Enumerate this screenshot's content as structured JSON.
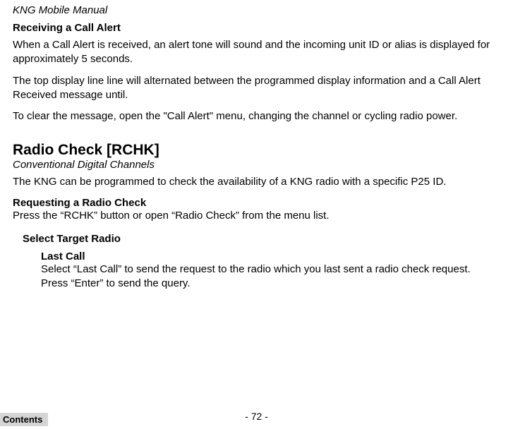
{
  "doc_title": "KNG Mobile Manual",
  "section1": {
    "heading": "Receiving a Call Alert",
    "p1": "When a Call Alert is received, an alert tone will sound and the incoming unit ID or alias is displayed for approximately 5 seconds.",
    "p2": "The top display line line will alternated between the programmed display information and a Call Alert Received message until.",
    "p3": "To clear the message, open the \"Call Alert\" menu, changing the channel or cycling radio power."
  },
  "section2": {
    "heading": "Radio Check [RCHK]",
    "subtitle": "Conventional Digital Channels",
    "p1": "The KNG can be programmed to check the availability of a KNG radio with a specific P25 ID.",
    "sub1_heading": "Requesting a Radio Check",
    "sub1_p1": "Press the “RCHK” button or open “Radio Check” from the menu list.",
    "sub2_heading": "Select Target Radio",
    "sub3_heading": "Last Call",
    "sub3_p1": "Select “Last Call” to send the request to the radio which you last sent a radio check request. Press “Enter” to send the query."
  },
  "footer": {
    "page": "- 72 -",
    "contents": "Contents"
  }
}
